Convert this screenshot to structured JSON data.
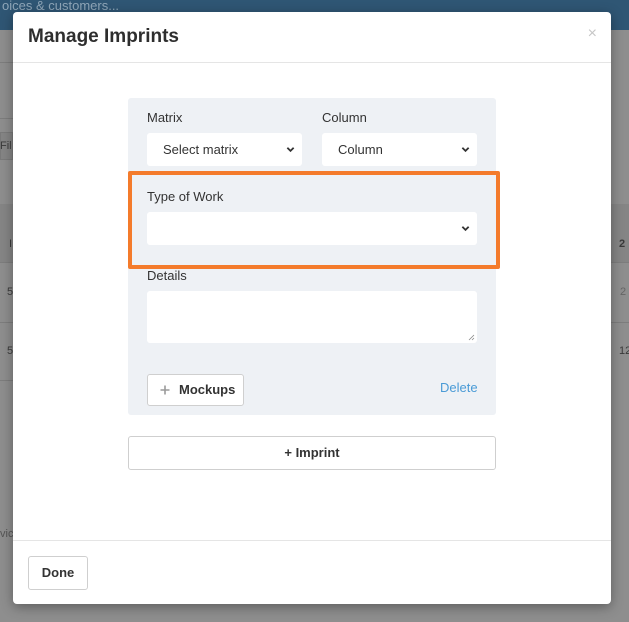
{
  "background": {
    "search_text": "oices & customers...",
    "fragments": [
      "Fil",
      "I",
      "5",
      "5",
      "2",
      "2",
      "12",
      "vic"
    ]
  },
  "modal": {
    "title": "Manage Imprints",
    "close_glyph": "×"
  },
  "imprint": {
    "matrix_label": "Matrix",
    "matrix_value": "Select matrix",
    "column_label": "Column",
    "column_value": "Column",
    "type_of_work_label": "Type of Work",
    "type_of_work_value": "",
    "details_label": "Details",
    "details_value": "",
    "mockups_label": "Mockups",
    "delete_label": "Delete"
  },
  "actions": {
    "add_imprint_label": "+ Imprint",
    "done_label": "Done"
  },
  "colors": {
    "highlight": "#f47b2b",
    "link": "#4a9bd6",
    "panel": "#eef1f5"
  },
  "icons": {
    "close": "close-icon",
    "chevron": "chevron-down-icon",
    "plus": "plus-icon"
  }
}
